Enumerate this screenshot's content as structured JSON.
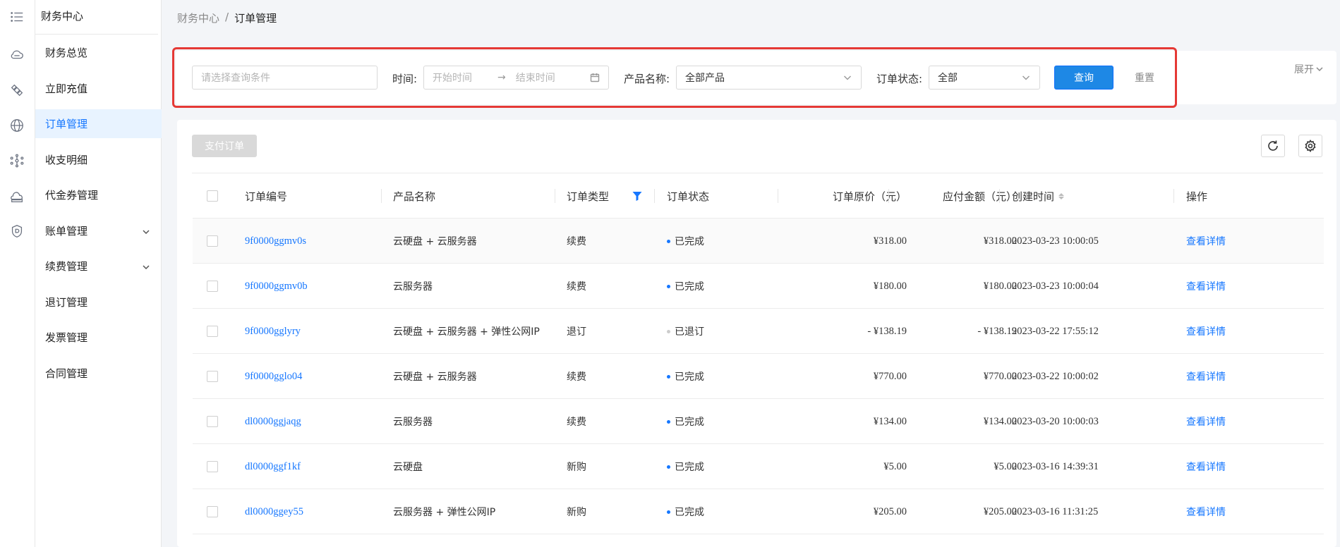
{
  "colors": {
    "primary": "#1e88e5",
    "link": "#1677ff",
    "active_bg": "#e8f3ff",
    "status_done": "#1677ff",
    "status_refund": "#cccccc",
    "highlight": "#e53935"
  },
  "rail": {
    "icons": [
      "menu-icon",
      "cloud-icon",
      "satellite-icon",
      "globe-icon",
      "network-icon",
      "cloud-storage-icon",
      "shield-icon"
    ]
  },
  "sidebar": {
    "title": "财务中心",
    "items": [
      {
        "label": "财务总览"
      },
      {
        "label": "立即充值"
      },
      {
        "label": "订单管理"
      },
      {
        "label": "收支明细"
      },
      {
        "label": "代金券管理"
      },
      {
        "label": "账单管理"
      },
      {
        "label": "续费管理"
      },
      {
        "label": "退订管理"
      },
      {
        "label": "发票管理"
      },
      {
        "label": "合同管理"
      }
    ]
  },
  "breadcrumb": {
    "root": "财务中心",
    "separator": "/",
    "current": "订单管理"
  },
  "filter": {
    "query_placeholder": "请选择查询条件",
    "time_label": "时间:",
    "start_placeholder": "开始时间",
    "end_placeholder": "结束时间",
    "product_label": "产品名称:",
    "product_value": "全部产品",
    "status_label": "订单状态:",
    "status_value": "全部",
    "search_button": "查询",
    "reset_button": "重置",
    "expand_label": "展开"
  },
  "toolbar": {
    "pay_button": "支付订单"
  },
  "table": {
    "headers": {
      "order_id": "订单编号",
      "product": "产品名称",
      "type": "订单类型",
      "status": "订单状态",
      "orig_price": "订单原价（元）",
      "payable": "应付金额（元）",
      "created": "创建时间",
      "action": "操作"
    },
    "rows": [
      {
        "order_id": "9f0000ggmv0s",
        "product": "云硬盘 + 云服务器",
        "type": "续费",
        "status": "已完成",
        "status_kind": "done",
        "orig_price": "¥318.00",
        "payable": "¥318.00",
        "created": "2023-03-23 10:00:05",
        "action": "查看详情"
      },
      {
        "order_id": "9f0000ggmv0b",
        "product": "云服务器",
        "type": "续费",
        "status": "已完成",
        "status_kind": "done",
        "orig_price": "¥180.00",
        "payable": "¥180.00",
        "created": "2023-03-23 10:00:04",
        "action": "查看详情"
      },
      {
        "order_id": "9f0000gglyry",
        "product": "云硬盘 + 云服务器 + 弹性公网IP",
        "type": "退订",
        "status": "已退订",
        "status_kind": "refund",
        "orig_price": "- ¥138.19",
        "payable": "- ¥138.19",
        "created": "2023-03-22 17:55:12",
        "action": "查看详情"
      },
      {
        "order_id": "9f0000gglo04",
        "product": "云硬盘 + 云服务器",
        "type": "续费",
        "status": "已完成",
        "status_kind": "done",
        "orig_price": "¥770.00",
        "payable": "¥770.00",
        "created": "2023-03-22 10:00:02",
        "action": "查看详情"
      },
      {
        "order_id": "dl0000ggjaqg",
        "product": "云服务器",
        "type": "续费",
        "status": "已完成",
        "status_kind": "done",
        "orig_price": "¥134.00",
        "payable": "¥134.00",
        "created": "2023-03-20 10:00:03",
        "action": "查看详情"
      },
      {
        "order_id": "dl0000ggf1kf",
        "product": "云硬盘",
        "type": "新购",
        "status": "已完成",
        "status_kind": "done",
        "orig_price": "¥5.00",
        "payable": "¥5.00",
        "created": "2023-03-16 14:39:31",
        "action": "查看详情"
      },
      {
        "order_id": "dl0000ggey55",
        "product": "云服务器 + 弹性公网IP",
        "type": "新购",
        "status": "已完成",
        "status_kind": "done",
        "orig_price": "¥205.00",
        "payable": "¥205.00",
        "created": "2023-03-16 11:31:25",
        "action": "查看详情"
      }
    ]
  }
}
